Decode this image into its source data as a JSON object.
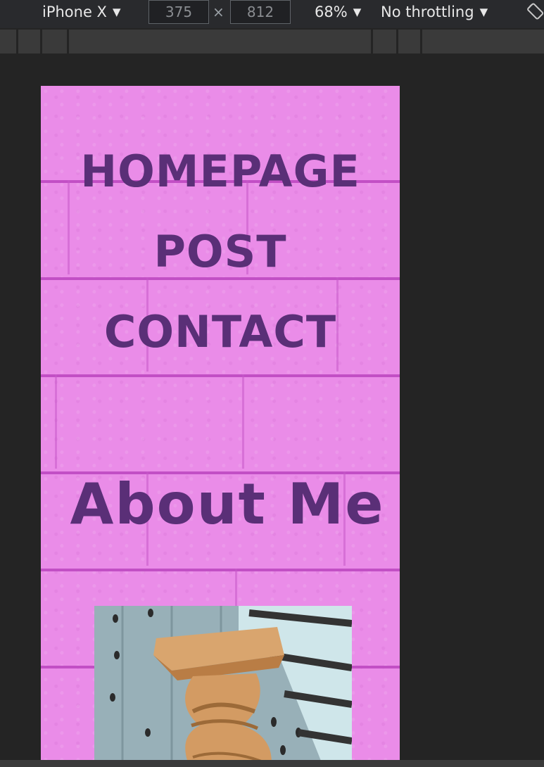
{
  "devtools": {
    "device_label": "iPhone X",
    "width_value": "375",
    "height_value": "812",
    "times_symbol": "×",
    "zoom_label": "68%",
    "throttle_label": "No throttling",
    "icons": [
      "dropdown-caret-icon",
      "rotate-icon"
    ]
  },
  "page": {
    "nav": [
      {
        "label": "HOMEPAGE"
      },
      {
        "label": "POST"
      },
      {
        "label": "CONTACT"
      }
    ],
    "about_heading": "About Me",
    "image_subject": "caryatid-column-photo",
    "colors": {
      "background": "#ea8ce8",
      "mortar": "#c24fc5",
      "text": "#5a2f77",
      "devtools_bg": "#292a2d"
    }
  }
}
